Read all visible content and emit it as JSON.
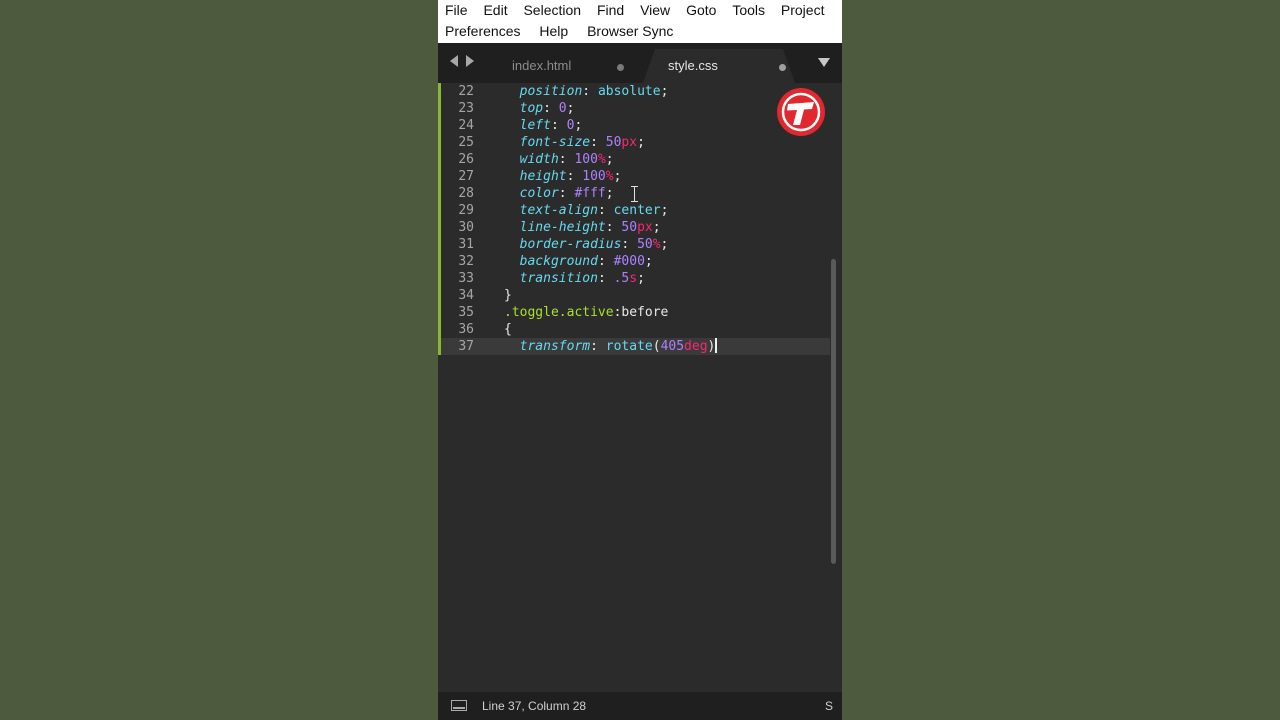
{
  "menu": {
    "row1": [
      "File",
      "Edit",
      "Selection",
      "Find",
      "View",
      "Goto",
      "Tools",
      "Project"
    ],
    "row2": [
      "Preferences",
      "Help",
      "Browser Sync"
    ]
  },
  "tabs": [
    {
      "label": "index.html",
      "active": false,
      "modified": true
    },
    {
      "label": "style.css",
      "active": true,
      "modified": true
    }
  ],
  "editor": {
    "lines": [
      {
        "n": "22",
        "indent": 2,
        "tokens": [
          [
            "prop",
            "position"
          ],
          [
            "punc",
            ": "
          ],
          [
            "val",
            "absolute"
          ],
          [
            "punc",
            ";"
          ]
        ]
      },
      {
        "n": "23",
        "indent": 2,
        "tokens": [
          [
            "prop",
            "top"
          ],
          [
            "punc",
            ": "
          ],
          [
            "num",
            "0"
          ],
          [
            "punc",
            ";"
          ]
        ]
      },
      {
        "n": "24",
        "indent": 2,
        "tokens": [
          [
            "prop",
            "left"
          ],
          [
            "punc",
            ": "
          ],
          [
            "num",
            "0"
          ],
          [
            "punc",
            ";"
          ]
        ]
      },
      {
        "n": "25",
        "indent": 2,
        "tokens": [
          [
            "prop",
            "font-size"
          ],
          [
            "punc",
            ": "
          ],
          [
            "num",
            "50"
          ],
          [
            "unit",
            "px"
          ],
          [
            "punc",
            ";"
          ]
        ]
      },
      {
        "n": "26",
        "indent": 2,
        "tokens": [
          [
            "prop",
            "width"
          ],
          [
            "punc",
            ": "
          ],
          [
            "num",
            "100"
          ],
          [
            "unit",
            "%"
          ],
          [
            "punc",
            ";"
          ]
        ]
      },
      {
        "n": "27",
        "indent": 2,
        "tokens": [
          [
            "prop",
            "height"
          ],
          [
            "punc",
            ": "
          ],
          [
            "num",
            "100"
          ],
          [
            "unit",
            "%"
          ],
          [
            "punc",
            ";"
          ]
        ]
      },
      {
        "n": "28",
        "indent": 2,
        "tokens": [
          [
            "prop",
            "color"
          ],
          [
            "punc",
            ": "
          ],
          [
            "num",
            "#fff"
          ],
          [
            "punc",
            ";"
          ]
        ]
      },
      {
        "n": "29",
        "indent": 2,
        "tokens": [
          [
            "prop",
            "text-align"
          ],
          [
            "punc",
            ": "
          ],
          [
            "val",
            "center"
          ],
          [
            "punc",
            ";"
          ]
        ]
      },
      {
        "n": "30",
        "indent": 2,
        "tokens": [
          [
            "prop",
            "line-height"
          ],
          [
            "punc",
            ": "
          ],
          [
            "num",
            "50"
          ],
          [
            "unit",
            "px"
          ],
          [
            "punc",
            ";"
          ]
        ]
      },
      {
        "n": "31",
        "indent": 2,
        "tokens": [
          [
            "prop",
            "border-radius"
          ],
          [
            "punc",
            ": "
          ],
          [
            "num",
            "50"
          ],
          [
            "unit",
            "%"
          ],
          [
            "punc",
            ";"
          ]
        ]
      },
      {
        "n": "32",
        "indent": 2,
        "tokens": [
          [
            "prop",
            "background"
          ],
          [
            "punc",
            ": "
          ],
          [
            "num",
            "#000"
          ],
          [
            "punc",
            ";"
          ]
        ]
      },
      {
        "n": "33",
        "indent": 2,
        "tokens": [
          [
            "prop",
            "transition"
          ],
          [
            "punc",
            ": "
          ],
          [
            "num",
            ".5"
          ],
          [
            "unit",
            "s"
          ],
          [
            "punc",
            ";"
          ]
        ]
      },
      {
        "n": "34",
        "indent": 0,
        "tokens": [
          [
            "punc",
            "}"
          ]
        ]
      },
      {
        "n": "35",
        "indent": 0,
        "tokens": [
          [
            "sel",
            ".toggle.active"
          ],
          [
            "text",
            ":before"
          ]
        ]
      },
      {
        "n": "36",
        "indent": 0,
        "tokens": [
          [
            "punc",
            "{"
          ]
        ]
      },
      {
        "n": "37",
        "indent": 2,
        "tokens": [
          [
            "prop",
            "transform"
          ],
          [
            "punc",
            ": "
          ],
          [
            "func",
            "rotate"
          ],
          [
            "punc",
            "("
          ],
          [
            "num",
            "405"
          ],
          [
            "unit",
            "deg"
          ],
          [
            "punc",
            ")"
          ]
        ],
        "current": true
      }
    ]
  },
  "statusbar": {
    "position": "Line 37, Column 28",
    "syntax": "S"
  },
  "logo": {
    "letter": "T",
    "color": "#e0282e"
  },
  "colors": {
    "background": "#4e5a3e",
    "editor_bg": "#2b2b2b",
    "modified_gutter": "#8ab92f"
  }
}
